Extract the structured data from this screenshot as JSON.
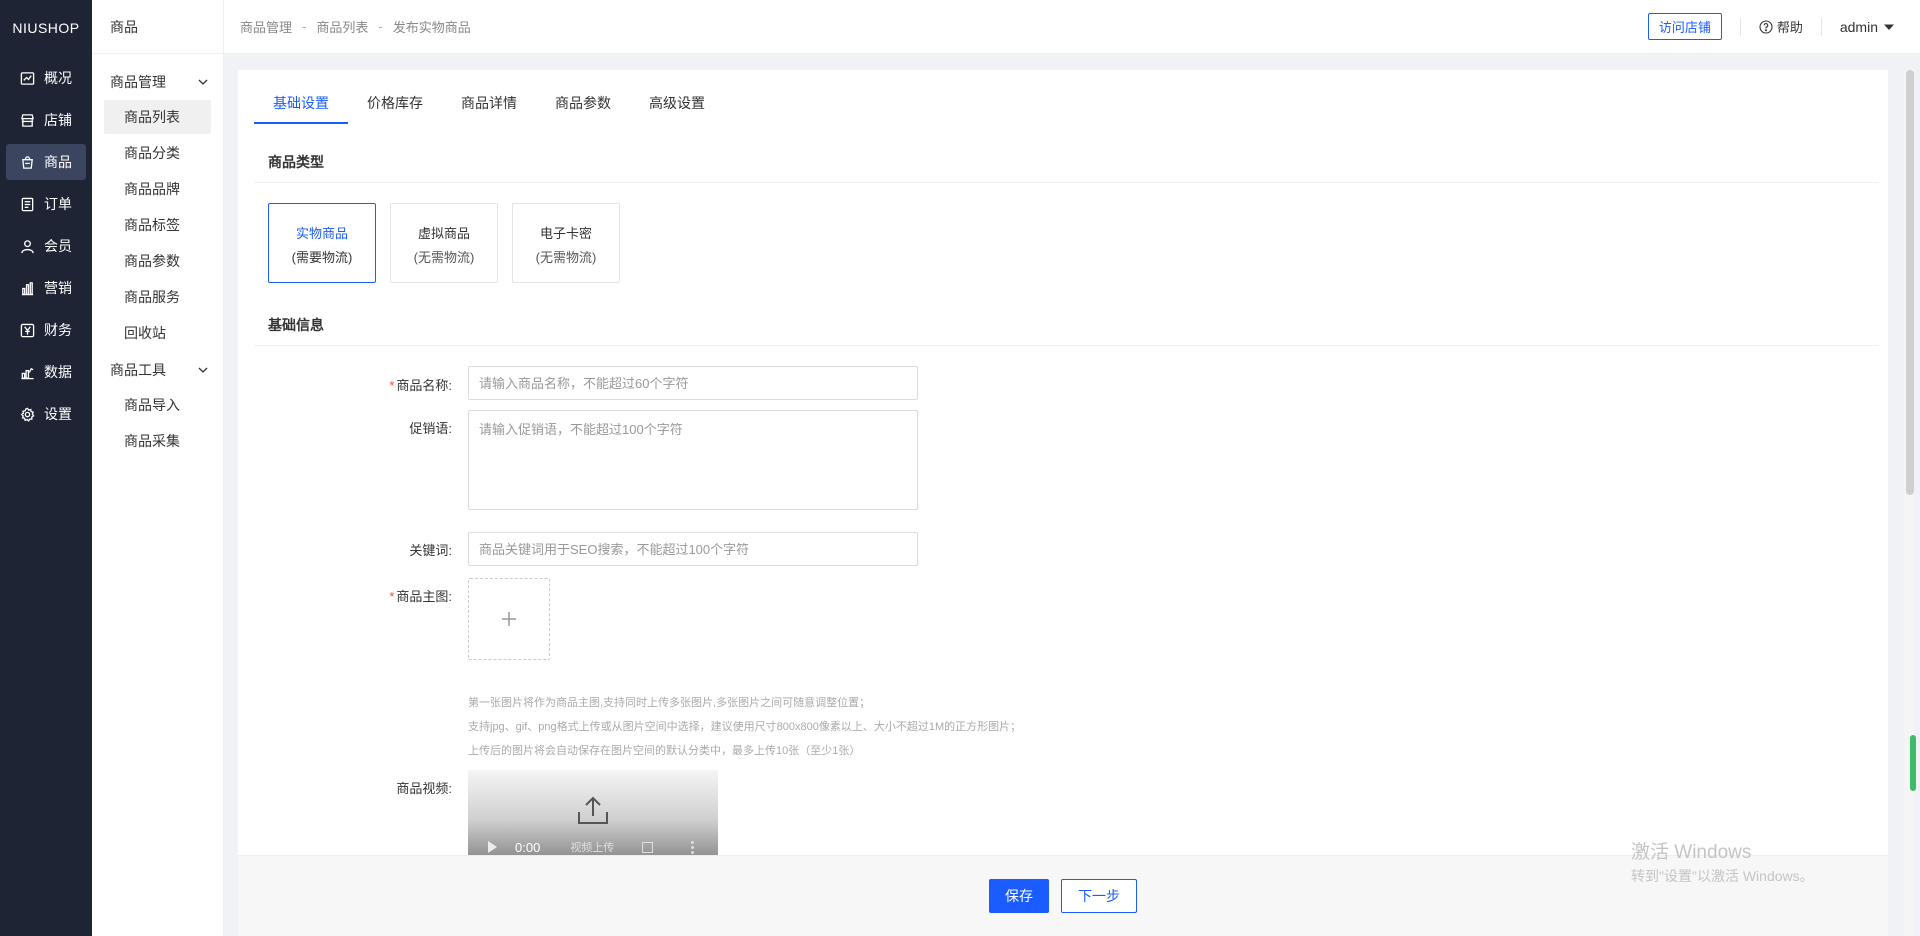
{
  "nav": {
    "logo": "NIUSHOP",
    "items": [
      {
        "label": "概况",
        "icon": "chart-line-icon"
      },
      {
        "label": "店铺",
        "icon": "store-icon"
      },
      {
        "label": "商品",
        "icon": "bag-icon"
      },
      {
        "label": "订单",
        "icon": "order-list-icon"
      },
      {
        "label": "会员",
        "icon": "user-icon"
      },
      {
        "label": "营销",
        "icon": "bar-chart-icon"
      },
      {
        "label": "财务",
        "icon": "yen-icon"
      },
      {
        "label": "数据",
        "icon": "data-icon"
      },
      {
        "label": "设置",
        "icon": "gear-icon"
      }
    ],
    "active_index": 2
  },
  "sidebar": {
    "title": "商品",
    "groups": [
      {
        "label": "商品管理",
        "items": [
          "商品列表",
          "商品分类",
          "商品品牌",
          "商品标签",
          "商品参数",
          "商品服务",
          "回收站"
        ]
      },
      {
        "label": "商品工具",
        "items": [
          "商品导入",
          "商品采集"
        ]
      }
    ],
    "active_item": "商品列表"
  },
  "header": {
    "breadcrumb": [
      "商品管理",
      "商品列表",
      "发布实物商品"
    ],
    "separator": "-",
    "visit_store": "访问店铺",
    "help": "帮助",
    "user": "admin"
  },
  "tabs": [
    "基础设置",
    "价格库存",
    "商品详情",
    "商品参数",
    "高级设置"
  ],
  "active_tab": 0,
  "product_type": {
    "title": "商品类型",
    "options": [
      {
        "name": "实物商品",
        "note": "(需要物流)"
      },
      {
        "name": "虚拟商品",
        "note": "(无需物流)"
      },
      {
        "name": "电子卡密",
        "note": "(无需物流)"
      }
    ],
    "selected": 0
  },
  "basic_info": {
    "title": "基础信息",
    "name_label": "商品名称:",
    "name_placeholder": "请输入商品名称，不能超过60个字符",
    "name_value": "",
    "promo_label": "促销语:",
    "promo_placeholder": "请输入促销语，不能超过100个字符",
    "promo_value": "",
    "keyword_label": "关键词:",
    "keyword_placeholder": "商品关键词用于SEO搜索，不能超过100个字符",
    "keyword_value": "",
    "image_label": "商品主图:",
    "image_hints": [
      "第一张图片将作为商品主图,支持同时上传多张图片,多张图片之间可随意调整位置；",
      "支持jpg、gif、png格式上传或从图片空间中选择，建议使用尺寸800x800像素以上、大小不超过1M的正方形图片；",
      "上传后的图片将会自动保存在图片空间的默认分类中，最多上传10张（至少1张）"
    ],
    "video_label": "商品视频:",
    "video_time": "0:00",
    "video_overlay": "视频上传"
  },
  "footer": {
    "save": "保存",
    "next": "下一步"
  },
  "watermark": {
    "line1": "激活 Windows",
    "line2": "转到\"设置\"以激活 Windows。"
  },
  "colors": {
    "primary": "#1a5cff",
    "nav_bg": "#1e2434",
    "required": "#f04a3e"
  }
}
